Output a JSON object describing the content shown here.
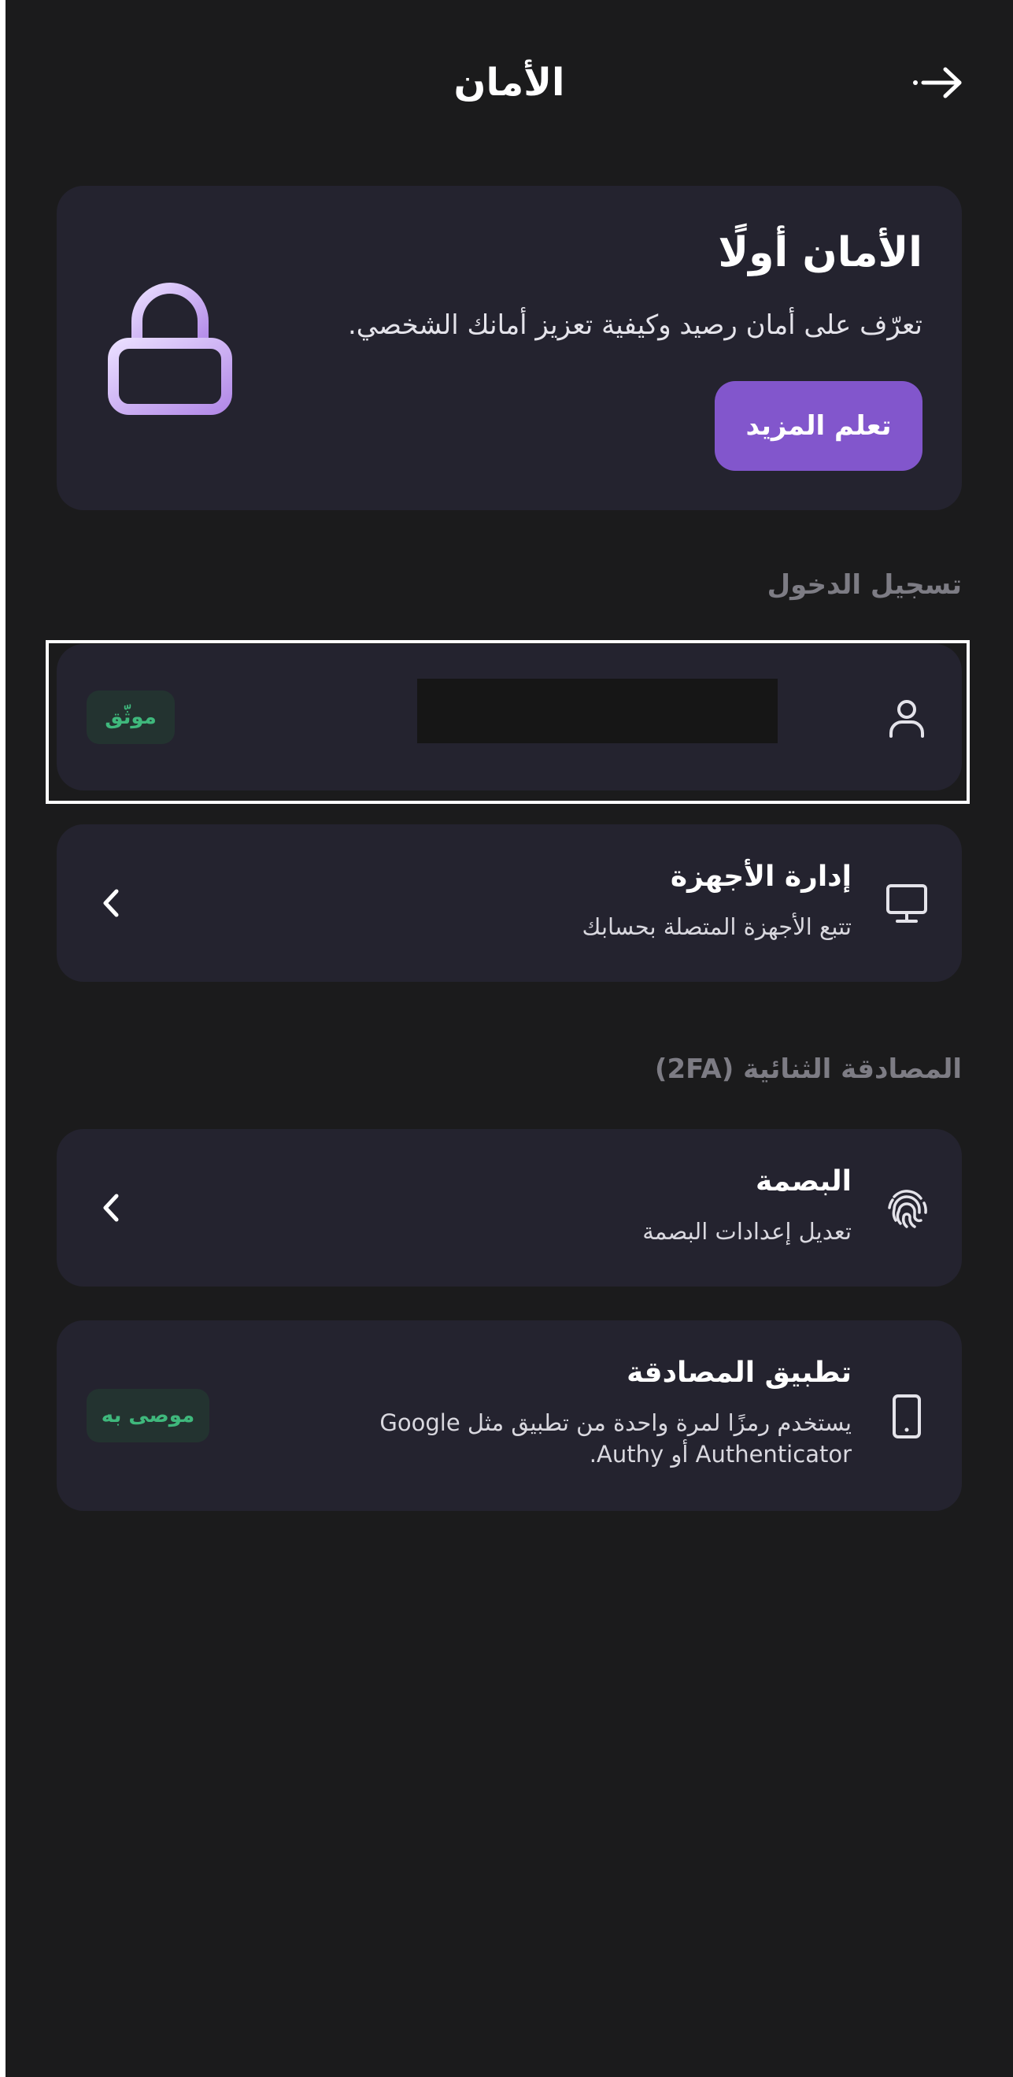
{
  "header": {
    "title": "الأمان",
    "back_icon": "arrow-right-icon"
  },
  "hero": {
    "title": "الأمان أولًا",
    "description": "تعرّف على أمان رصيد وكيفية تعزيز أمانك الشخصي.",
    "button_label": "تعلم المزيد",
    "icon": "lock-icon",
    "accent_color": "#8256cc"
  },
  "login_section": {
    "title": "تسجيل الدخول",
    "account_item": {
      "icon": "user-icon",
      "badge": "موثّق"
    },
    "devices_item": {
      "icon": "monitor-icon",
      "title": "إدارة الأجهزة",
      "subtitle": "تتبع الأجهزة المتصلة بحسابك"
    }
  },
  "twofa_section": {
    "title": "المصادقة الثنائية (2FA)",
    "fingerprint_item": {
      "icon": "fingerprint-icon",
      "title": "البصمة",
      "subtitle": "تعديل إعدادات البصمة"
    },
    "authenticator_item": {
      "icon": "smartphone-icon",
      "title": "تطبيق المصادقة",
      "subtitle": "يستخدم رمزًا لمرة واحدة من تطبيق مثل Google Authenticator أو Authy.",
      "badge": "موصى به"
    }
  },
  "colors": {
    "background": "#1b1b1c",
    "card": "#24232f",
    "badge_text": "#3fb87c",
    "section_title": "#7d7c84"
  }
}
